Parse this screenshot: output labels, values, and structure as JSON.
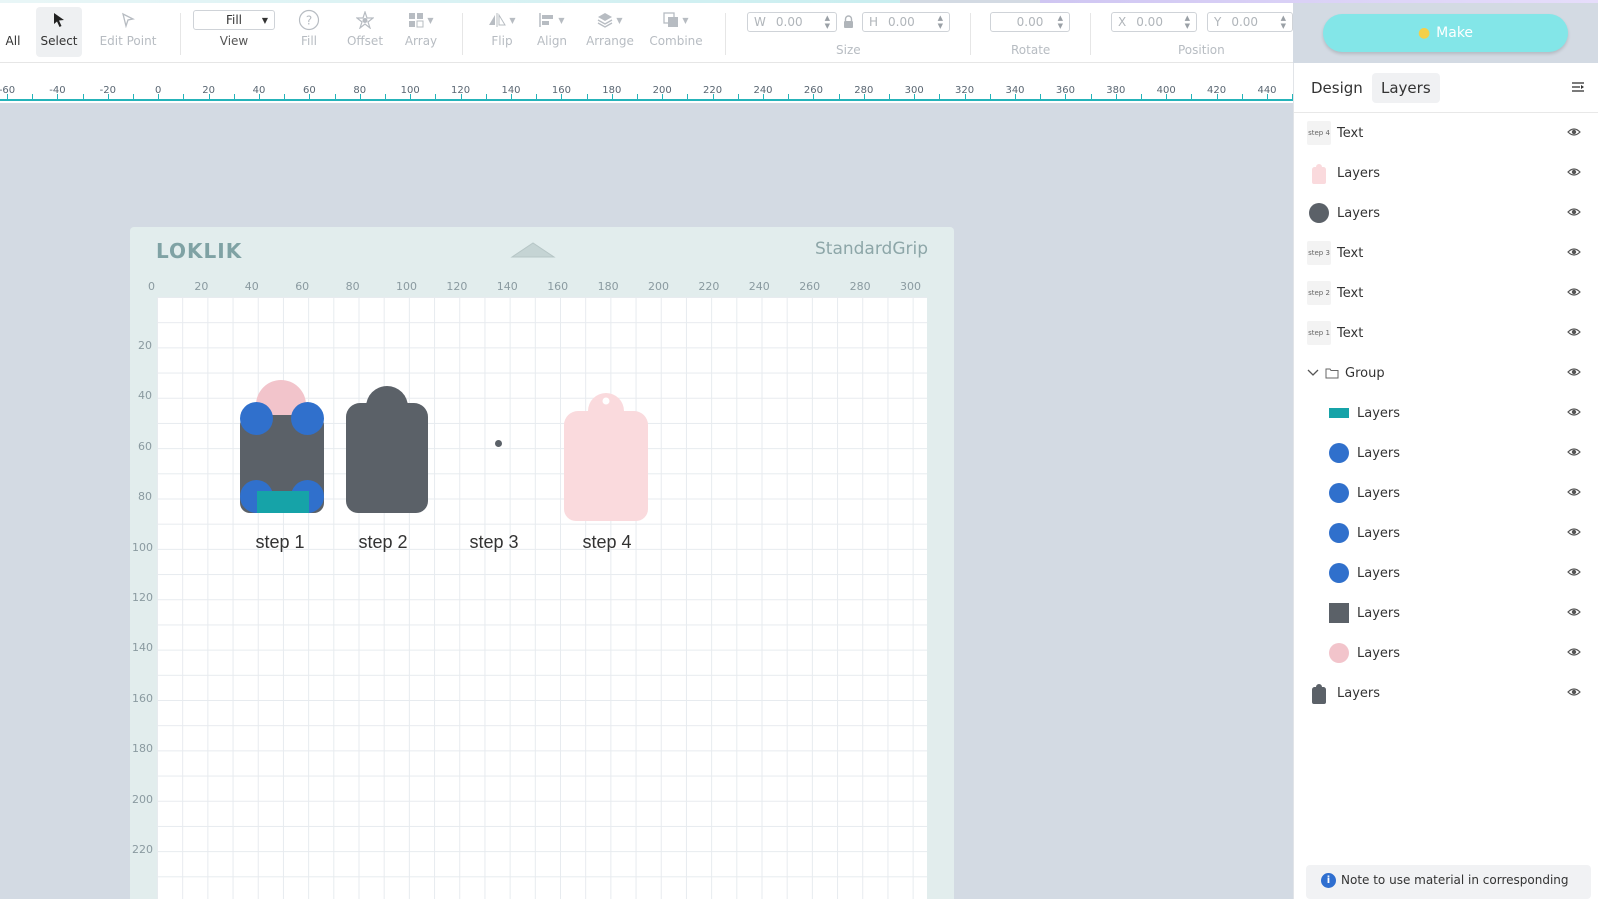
{
  "toolbar": {
    "tools": [
      {
        "name": "select-all",
        "label": "All"
      },
      {
        "name": "select",
        "label": "Select"
      },
      {
        "name": "edit-point",
        "label": "Edit Point"
      },
      {
        "name": "view",
        "label": "View",
        "value": "Fill"
      },
      {
        "name": "fill",
        "label": "Fill"
      },
      {
        "name": "offset",
        "label": "Offset"
      },
      {
        "name": "array",
        "label": "Array"
      },
      {
        "name": "flip",
        "label": "Flip"
      },
      {
        "name": "align",
        "label": "Align"
      },
      {
        "name": "arrange",
        "label": "Arrange"
      },
      {
        "name": "combine",
        "label": "Combine"
      }
    ],
    "size": {
      "label": "Size",
      "w_label": "W",
      "w_value": "0.00",
      "h_label": "H",
      "h_value": "0.00"
    },
    "rotate": {
      "label": "Rotate",
      "value": "0.00"
    },
    "position": {
      "label": "Position",
      "x_label": "X",
      "x_value": "0.00",
      "y_label": "Y",
      "y_value": "0.00"
    },
    "make_label": "Make"
  },
  "ruler": {
    "labels": [
      "-60",
      "-40",
      "-20",
      "0",
      "20",
      "40",
      "60",
      "80",
      "100",
      "120",
      "140",
      "160",
      "180",
      "200",
      "220",
      "240",
      "260",
      "280",
      "300",
      "320",
      "340",
      "360",
      "380",
      "400",
      "420",
      "440"
    ]
  },
  "mat": {
    "brand": "LOKLIK",
    "name": "StandardGrip",
    "top_labels": [
      "0",
      "20",
      "40",
      "60",
      "80",
      "100",
      "120",
      "140",
      "160",
      "180",
      "200",
      "220",
      "240",
      "260",
      "280",
      "300"
    ],
    "side_labels": [
      "20",
      "40",
      "60",
      "80",
      "100",
      "120",
      "140",
      "160",
      "180",
      "200",
      "220"
    ]
  },
  "canvas": {
    "step_labels": [
      "step 1",
      "step 2",
      "step 3",
      "step 4"
    ],
    "colors": {
      "dark": "#5b6168",
      "blue": "#3070cc",
      "pink": "#f2c4cb",
      "light_pink": "#fadadd",
      "teal": "#16a3a8"
    }
  },
  "panel": {
    "tabs": [
      "Design",
      "Layers"
    ],
    "active_tab": "Layers",
    "layers": [
      {
        "thumb": "text",
        "thumb_text": "step 4",
        "name": "Text",
        "indent": 0
      },
      {
        "thumb": "tag-pink",
        "name": "Layers",
        "indent": 0
      },
      {
        "thumb": "circle-dark",
        "name": "Layers",
        "indent": 0
      },
      {
        "thumb": "text",
        "thumb_text": "step 3",
        "name": "Text",
        "indent": 0
      },
      {
        "thumb": "text",
        "thumb_text": "step 2",
        "name": "Text",
        "indent": 0
      },
      {
        "thumb": "text",
        "thumb_text": "step 1",
        "name": "Text",
        "indent": 0
      },
      {
        "thumb": "group",
        "name": "Group",
        "indent": 0,
        "expanded": true
      },
      {
        "thumb": "rect-teal",
        "name": "Layers",
        "indent": 1
      },
      {
        "thumb": "circle-blue",
        "name": "Layers",
        "indent": 1
      },
      {
        "thumb": "circle-blue",
        "name": "Layers",
        "indent": 1
      },
      {
        "thumb": "circle-blue",
        "name": "Layers",
        "indent": 1
      },
      {
        "thumb": "circle-blue",
        "name": "Layers",
        "indent": 1
      },
      {
        "thumb": "rect-dark",
        "name": "Layers",
        "indent": 1
      },
      {
        "thumb": "circle-pink",
        "name": "Layers",
        "indent": 1
      },
      {
        "thumb": "tag-dark",
        "name": "Layers",
        "indent": 0
      }
    ],
    "note": "Note to use material in corresponding"
  }
}
